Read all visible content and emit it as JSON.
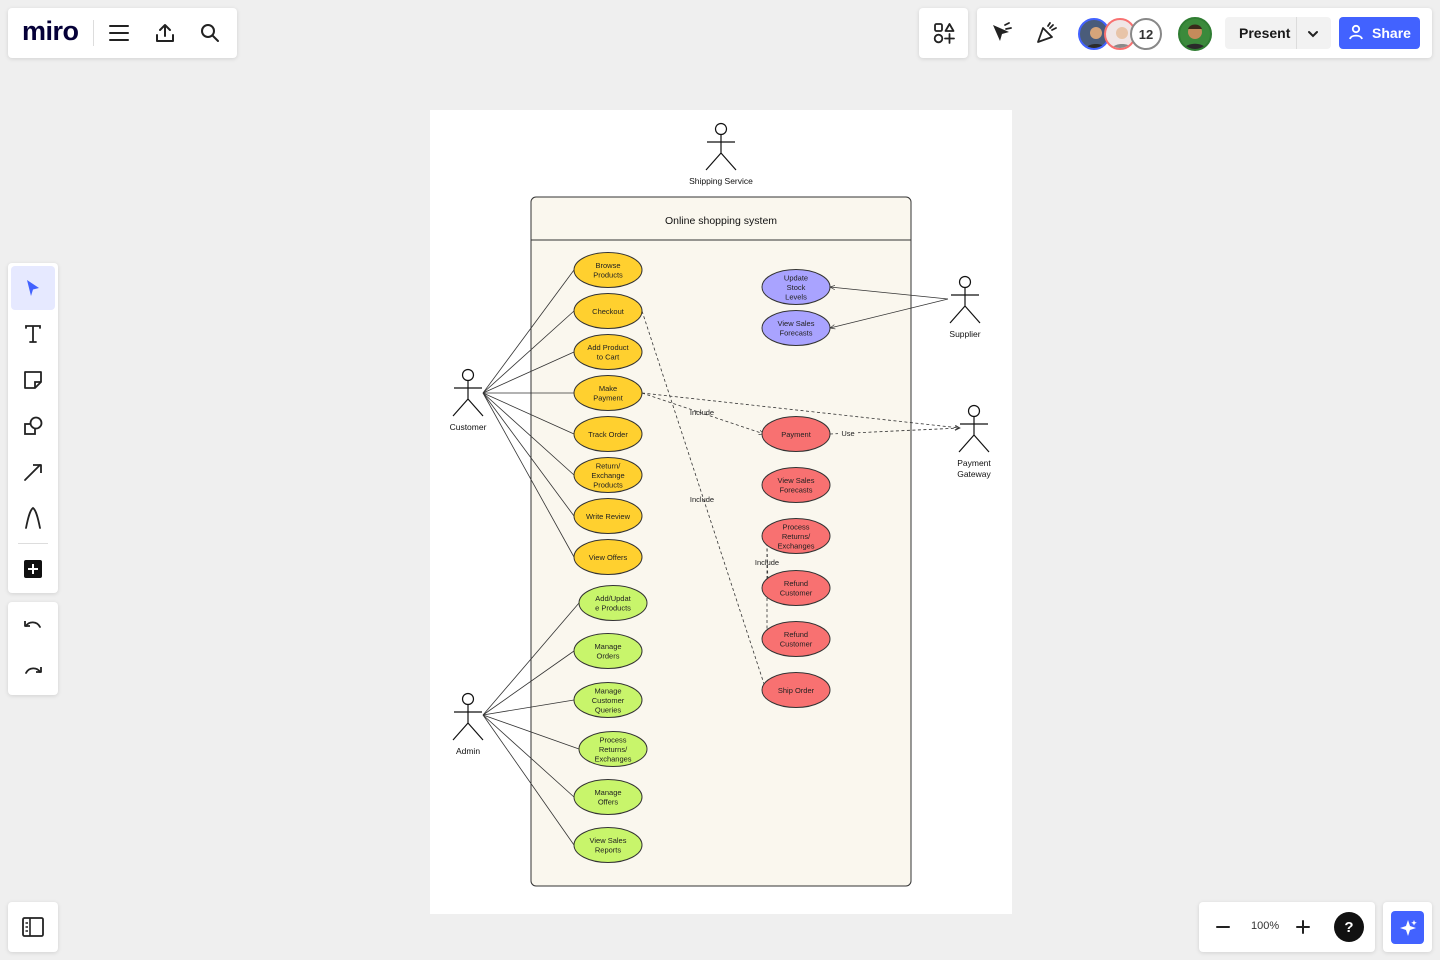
{
  "app": {
    "logo": "miro"
  },
  "top_left": {
    "icons": [
      "menu-icon",
      "upload-icon",
      "search-icon"
    ]
  },
  "top_right": {
    "apps_icon": "apps-icon",
    "icons": [
      "reaction-cursor-icon",
      "celebrate-icon"
    ],
    "collaborator_count": "12",
    "present_label": "Present",
    "share_label": "Share"
  },
  "left_toolbar": {
    "tools": [
      "select-tool",
      "text-tool",
      "sticky-note-tool",
      "shapes-tool",
      "connector-tool",
      "pen-tool",
      "more-tools"
    ],
    "undo": "undo",
    "redo": "redo"
  },
  "bottom": {
    "zoom": "100%",
    "help": "?"
  },
  "diagram": {
    "system_title": "Online shopping system",
    "actors": {
      "shipping": "Shipping Service",
      "customer": "Customer",
      "supplier": "Supplier",
      "gateway_line1": "Payment",
      "gateway_line2": "Gateway",
      "admin": "Admin"
    },
    "customer_usecases": [
      [
        "Browse",
        "Products"
      ],
      [
        "Checkout"
      ],
      [
        "Add Product",
        "to Cart"
      ],
      [
        "Make",
        "Payment"
      ],
      [
        "Track Order"
      ],
      [
        "Return/",
        "Exchange",
        "Products"
      ],
      [
        "Write Review"
      ],
      [
        "View Offers"
      ]
    ],
    "admin_usecases": [
      [
        "Add/Updat",
        "e Products"
      ],
      [
        "Manage",
        "Orders"
      ],
      [
        "Manage",
        "Customer",
        "Queries"
      ],
      [
        "Process",
        "Returns/",
        "Exchanges"
      ],
      [
        "Manage",
        "Offers"
      ],
      [
        "View Sales",
        "Reports"
      ]
    ],
    "supplier_usecases": [
      [
        "Update",
        "Stock",
        "Levels"
      ],
      [
        "View Sales",
        "Forecasts"
      ]
    ],
    "system_usecases": [
      [
        "Payment"
      ],
      [
        "View Sales",
        "Forecasts"
      ],
      [
        "Process",
        "Returns/",
        "Exchanges"
      ],
      [
        "Refund",
        "Customer"
      ],
      [
        "Refund",
        "Customer"
      ],
      [
        "Ship Order"
      ]
    ],
    "relation_labels": {
      "include1": "Include",
      "include2": "Include",
      "include3": "Include",
      "use": "Use"
    },
    "colors": {
      "customer": "#ffd02f",
      "admin": "#c8f56b",
      "supplier": "#a9a3ff",
      "system": "#f87171",
      "boundary_fill": "#faf7ee"
    }
  }
}
